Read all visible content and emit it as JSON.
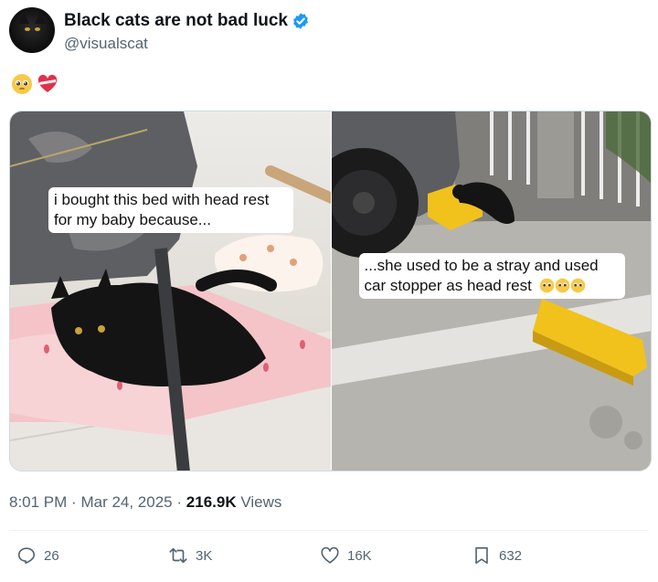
{
  "author": {
    "display_name": "Black cats are not bad luck",
    "handle": "@visualscat",
    "verified_icon": "verified-badge-icon",
    "accent_color": "#1d9bf0"
  },
  "post": {
    "emojis": [
      "pleading-face-emoji",
      "heart-with-ribbon-emoji"
    ],
    "media": {
      "left_caption": "i bought this bed with head rest for my baby because...",
      "right_caption_text": "...she used to be a stray and used car stopper as head rest",
      "right_caption_emojis": [
        "pleading-face-emoji",
        "pleading-face-emoji",
        "pleading-face-emoji"
      ]
    },
    "time": "8:01 PM",
    "date": "Mar 24, 2025",
    "separator": "·",
    "views_count": "216.9K",
    "views_label": "Views"
  },
  "actions": {
    "replies": "26",
    "reposts": "3K",
    "likes": "16K",
    "bookmarks": "632"
  }
}
